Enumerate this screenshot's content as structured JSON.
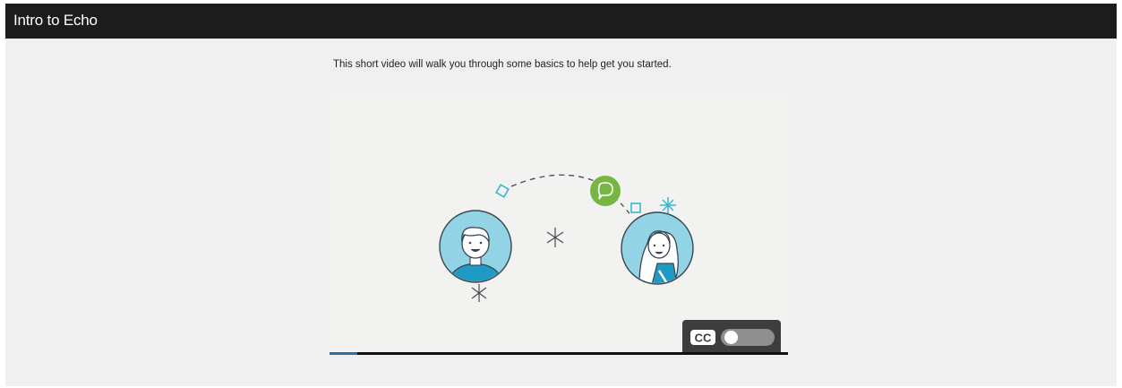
{
  "window": {
    "title": "Intro to Echo"
  },
  "main": {
    "intro_text": "This short video will walk you through some basics to help get you started."
  },
  "video": {
    "progress_percent": 6,
    "captions": {
      "icon": "closed-captions-icon",
      "label": "CC",
      "enabled": false
    },
    "illustration": {
      "left_avatar": "man-avatar-icon",
      "right_avatar": "woman-avatar-icon",
      "center_icon": "speech-bubble-icon"
    }
  },
  "colors": {
    "title_bar": "#1c1c1c",
    "page_background": "#f0f0f0",
    "accent_teal": "#3bb4d4",
    "accent_green": "#78b643",
    "progress_fill": "#2b6fa5"
  }
}
